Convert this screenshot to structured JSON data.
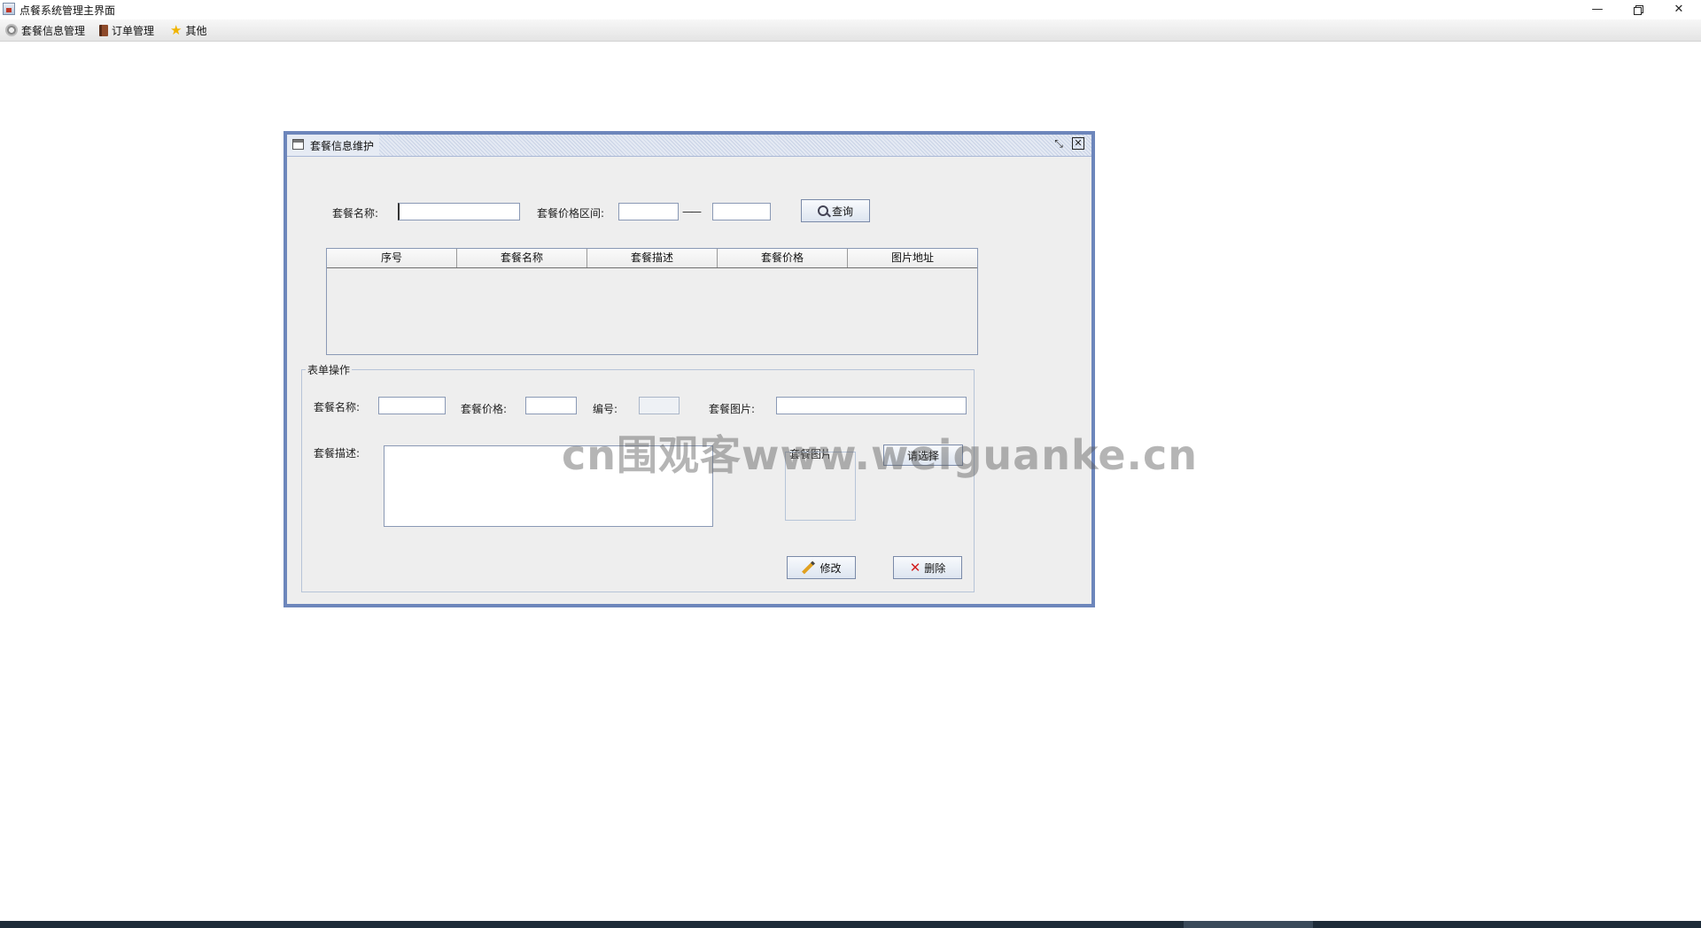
{
  "window": {
    "title": "点餐系统管理主界面",
    "minimize_glyph": "—",
    "close_glyph": "✕"
  },
  "menubar": {
    "items": [
      {
        "label": "套餐信息管理",
        "icon": "gear-icon"
      },
      {
        "label": "订单管理",
        "icon": "book-icon"
      },
      {
        "label": "其他",
        "icon": "star-icon"
      }
    ]
  },
  "internal_frame": {
    "title": "套餐信息维护",
    "minimize_glyph": "⤡",
    "close_glyph": "✕"
  },
  "search": {
    "name_label": "套餐名称:",
    "name_value": "",
    "price_range_label": "套餐价格区间:",
    "price_min_value": "",
    "range_separator": "——",
    "price_max_value": "",
    "query_label": "查询"
  },
  "table": {
    "columns": [
      "序号",
      "套餐名称",
      "套餐描述",
      "套餐价格",
      "图片地址"
    ],
    "rows": []
  },
  "form": {
    "panel_title": "表单操作",
    "name_label": "套餐名称:",
    "name_value": "",
    "price_label": "套餐价格:",
    "price_value": "",
    "id_label": "编号:",
    "id_value": "",
    "image_label": "套餐图片:",
    "image_value": "",
    "desc_label": "套餐描述:",
    "desc_value": "",
    "image_preview_label": "套餐图片",
    "choose_label": "请选择",
    "modify_label": "修改",
    "delete_label": "删除"
  },
  "watermark": "cn围观客www.weiguanke.cn",
  "colors": {
    "frame_border": "#6d86bb",
    "panel_bg": "#eeeeee",
    "delete_icon": "#d21f1f",
    "star_icon": "#f0b400"
  }
}
